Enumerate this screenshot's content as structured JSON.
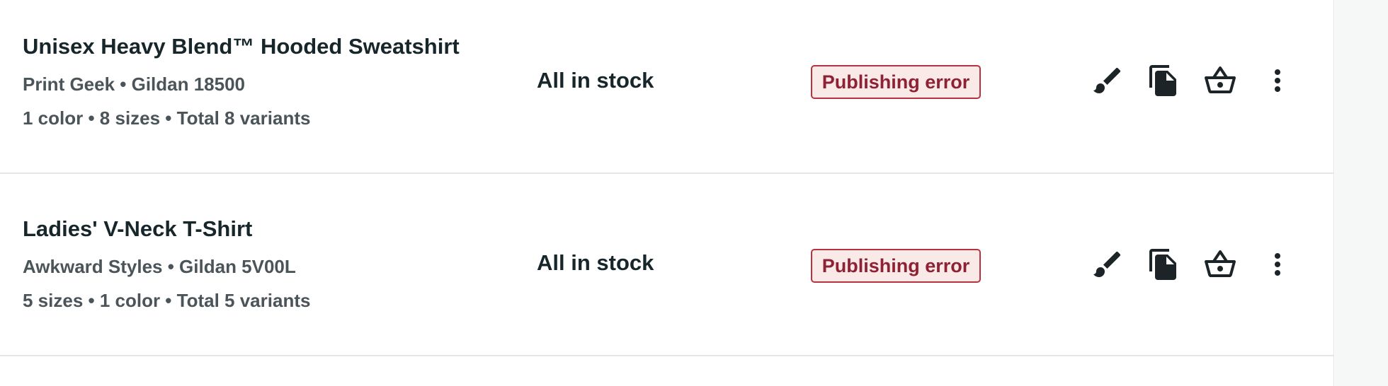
{
  "products": [
    {
      "title": "Unisex Heavy Blend™ Hooded Sweatshirt",
      "brand_model": "Print Geek • Gildan 18500",
      "variants_summary": "1 color • 8 sizes • Total 8 variants",
      "stock_status": "All in stock",
      "status_badge": "Publishing error"
    },
    {
      "title": "Ladies' V-Neck T-Shirt",
      "brand_model": "Awkward Styles • Gildan 5V00L",
      "variants_summary": "5 sizes • 1 color • Total 5 variants",
      "stock_status": "All in stock",
      "status_badge": "Publishing error"
    }
  ],
  "actions": {
    "edit_icon": "brush-icon",
    "duplicate_icon": "copy-icon",
    "order_icon": "basket-icon",
    "more_icon": "more-vertical-icon"
  },
  "colors": {
    "text_primary": "#17262b",
    "text_secondary": "#4a5459",
    "error_text": "#8f2135",
    "error_border": "#b8323f",
    "error_bg": "#f9e9e7",
    "divider": "#e3e5e6"
  }
}
